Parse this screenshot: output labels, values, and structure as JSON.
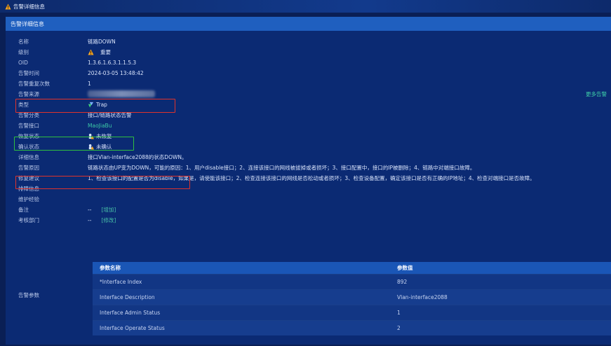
{
  "window": {
    "title": "告警详细信息"
  },
  "panel": {
    "header": "告警详细信息",
    "more_link": "更多告警"
  },
  "fields": [
    {
      "label": "名称",
      "value": "链路DOWN"
    },
    {
      "label": "级别",
      "value": "重要",
      "icon": "warning-triangle-icon"
    },
    {
      "label": "OID",
      "value": "1.3.6.1.6.3.1.1.5.3"
    },
    {
      "label": "告警时间",
      "value": "2024-03-05 13:48:42"
    },
    {
      "label": "告警重复次数",
      "value": "1"
    },
    {
      "label": "告警来源",
      "value": ""
    },
    {
      "label": "类型",
      "value": "Trap",
      "icon": "trap-icon"
    },
    {
      "label": "告警分类",
      "value": "接口/链路状态告警"
    },
    {
      "label": "告警接口",
      "value": "MaoJiaBu"
    },
    {
      "label": "恢复状态",
      "value": "未恢复",
      "icon": "warning-person-icon"
    },
    {
      "label": "确认状态",
      "value": "未确认",
      "icon": "warning-person-icon"
    },
    {
      "label": "详细信息",
      "value": "接口Vlan-interface2088的状态DOWN。"
    },
    {
      "label": "告警原因",
      "value": "链路状态由UP变为DOWN，可能的原因：1、用户disable接口；2、连接该接口的网线被拔掉或者损坏；3、接口配置中，接口的IP被删除；4、链路中对端接口故障。"
    },
    {
      "label": "修复建议",
      "value": "1、检查该接口的配置是否为disable，如果是，请使能该接口；2、检查连接该接口的网线是否松动或者损坏；3、检查设备配置，确定该接口是否有正确的IP地址；4、检查对端接口是否故障。"
    },
    {
      "label": "排障信息",
      "value": ""
    },
    {
      "label": "维护经验",
      "value": ""
    },
    {
      "label": "备注",
      "value": "--",
      "action": "[增加]"
    },
    {
      "label": "考核部门",
      "value": "--",
      "action": "[修改]"
    }
  ],
  "params": {
    "label": "告警参数",
    "columns": [
      "参数名称",
      "参数值"
    ],
    "rows": [
      [
        "*Interface Index",
        "892"
      ],
      [
        "Interface Description",
        "Vlan-interface2088"
      ],
      [
        "Interface Admin Status",
        "1"
      ],
      [
        "Interface Operate Status",
        "2"
      ]
    ]
  },
  "colors": {
    "accent": "#1f5fbf",
    "highlight_red": "#e0332b",
    "highlight_green": "#2fbf3f"
  }
}
